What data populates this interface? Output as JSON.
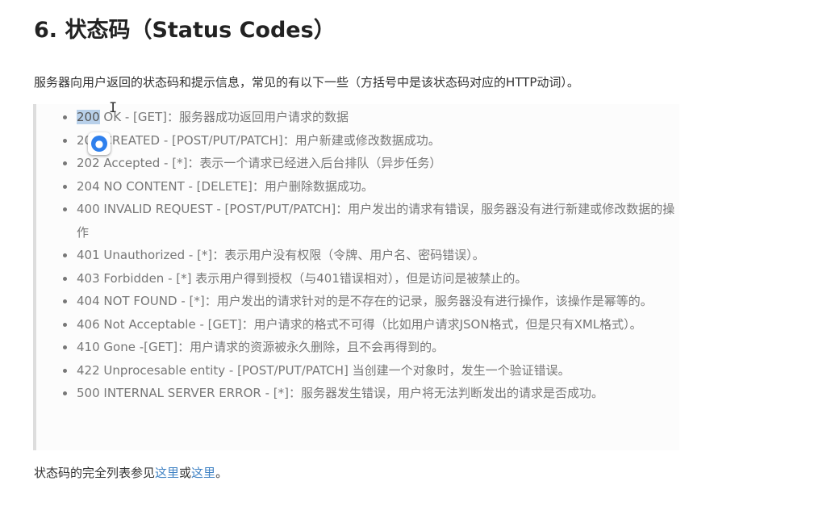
{
  "heading": "6. 状态码（Status Codes）",
  "intro": "服务器向用户返回的状态码和提示信息，常见的有以下一些（方括号中是该状态码对应的HTTP动词）。",
  "status_codes": [
    {
      "code": "200",
      "rest": " OK - [GET]：服务器成功返回用户请求的数据"
    },
    {
      "code": "201",
      "rest": " CREATED - [POST/PUT/PATCH]：用户新建或修改数据成功。"
    },
    {
      "code": "202",
      "rest": " Accepted - [*]：表示一个请求已经进入后台排队（异步任务）"
    },
    {
      "code": "204",
      "rest": " NO CONTENT - [DELETE]：用户删除数据成功。"
    },
    {
      "code": "400",
      "rest": " INVALID REQUEST - [POST/PUT/PATCH]：用户发出的请求有错误，服务器没有进行新建或修改数据的操作"
    },
    {
      "code": "401",
      "rest": " Unauthorized - [*]：表示用户没有权限（令牌、用户名、密码错误）。"
    },
    {
      "code": "403",
      "rest": " Forbidden - [*] 表示用户得到授权（与401错误相对），但是访问是被禁止的。"
    },
    {
      "code": "404",
      "rest": " NOT FOUND - [*]：用户发出的请求针对的是不存在的记录，服务器没有进行操作，该操作是幂等的。"
    },
    {
      "code": "406",
      "rest": " Not Acceptable - [GET]：用户请求的格式不可得（比如用户请求JSON格式，但是只有XML格式）。"
    },
    {
      "code": "410",
      "rest": " Gone -[GET]：用户请求的资源被永久删除，且不会再得到的。"
    },
    {
      "code": "422",
      "rest": " Unprocesable entity - [POST/PUT/PATCH] 当创建一个对象时，发生一个验证错误。"
    },
    {
      "code": "500",
      "rest": " INTERNAL SERVER ERROR - [*]：服务器发生错误，用户将无法判断发出的请求是否成功。"
    }
  ],
  "footer": {
    "prefix": "状态码的完全列表参见",
    "link1": "这里",
    "middle": "或",
    "link2": "这里",
    "suffix": "。"
  },
  "overlay": {
    "cursor_icon": "text-cursor-icon",
    "floating_icon": "floating-app-icon"
  },
  "colors": {
    "heading": "#222222",
    "body": "#333333",
    "list_text": "#777777",
    "link": "#4183c4",
    "quote_border": "#dddddd",
    "selection": "#b8d0ea"
  }
}
